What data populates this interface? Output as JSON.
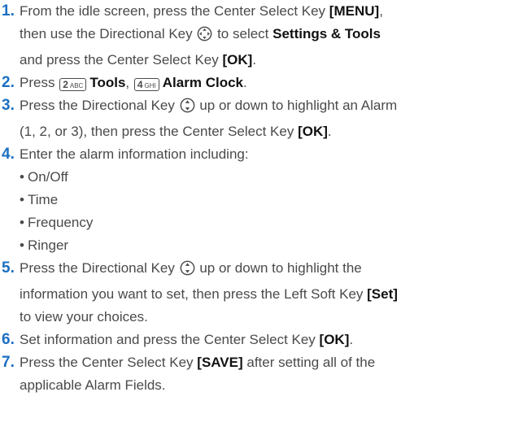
{
  "steps": [
    {
      "num": "1.",
      "lines": [
        [
          "From the idle screen, press the Center Select Key ",
          "[MENU]",
          ","
        ],
        [
          "then use the Directional Key ",
          " to select ",
          "Settings & Tools"
        ],
        [
          "and press the Center Select Key ",
          "[OK]",
          "."
        ]
      ]
    },
    {
      "num": "2.",
      "parts": {
        "pre": "Press ",
        "key1_digit": "2",
        "key1_letters": "ABC",
        "item1": "Tools",
        "sep": ", ",
        "key2_digit": "4",
        "key2_letters": "GHI",
        "item2": "Alarm Clock",
        "end": "."
      }
    },
    {
      "num": "3.",
      "parts": {
        "pre": "Press the Directional Key ",
        "post": " up or down to highlight an Alarm",
        "line2_pre": "(1, 2, or 3), then press the Center Select Key ",
        "bold": "[OK]",
        "end": "."
      }
    },
    {
      "num": "4.",
      "text": "Enter the alarm information including:",
      "bullets": [
        "On/Off",
        "Time",
        "Frequency",
        "Ringer"
      ]
    },
    {
      "num": "5.",
      "parts": {
        "pre": "Press the Directional Key ",
        "post": " up or down to highlight the",
        "line2": "information you want to set, then press the Left Soft Key ",
        "bold": "[Set]",
        "line3": "to view your choices."
      }
    },
    {
      "num": "6.",
      "parts": {
        "pre": "Set information and press the Center Select Key ",
        "bold": "[OK]",
        "end": "."
      }
    },
    {
      "num": "7.",
      "parts": {
        "pre": "Press the Center Select Key ",
        "bold": "[SAVE]",
        "post": " after setting all of the",
        "line2": "applicable Alarm Fields."
      }
    }
  ],
  "icons": {
    "dir_four_way": "four-way-directional-key-icon",
    "dir_up_down": "up-down-directional-key-icon"
  },
  "colors": {
    "number": "#1b6fc2",
    "text": "#4a4a4a",
    "bold": "#111111"
  }
}
